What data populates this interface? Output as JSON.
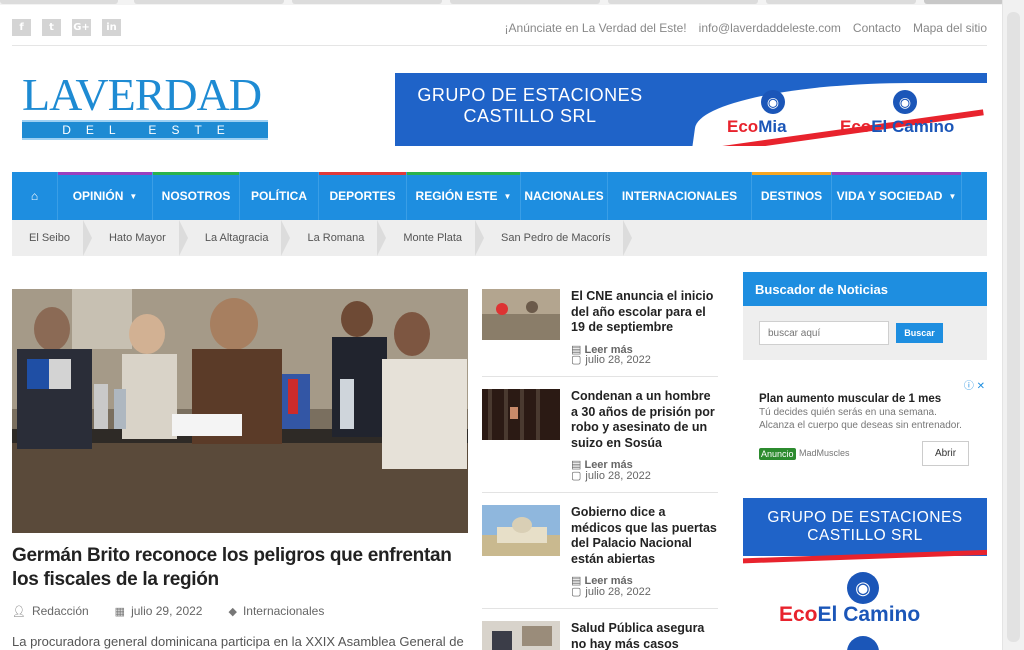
{
  "social": [
    "f",
    "t",
    "G+",
    "in"
  ],
  "top_links": [
    "¡Anúnciate en La Verdad del Este!",
    "info@laverdaddeleste.com",
    "Contacto",
    "Mapa del sitio"
  ],
  "logo": {
    "word": "LAVERDAD",
    "band": "DEL ESTE"
  },
  "banner": {
    "line1": "GRUPO DE ESTACIONES",
    "line2": "CASTILLO SRL",
    "brand1_prefix": "Eco",
    "brand1_suffix": "Mia",
    "brand2_prefix": "Eco",
    "brand2_suffix": "El Camino"
  },
  "main_nav": [
    {
      "label": "⌂",
      "color": "#1e8ee0"
    },
    {
      "label": "OPINIÓN",
      "caret": "▼",
      "color": "#9b3fbf"
    },
    {
      "label": "NOSOTROS",
      "color": "#2bb24c"
    },
    {
      "label": "POLÍTICA",
      "color": "#1e8ee0"
    },
    {
      "label": "DEPORTES",
      "color": "#e03a3a"
    },
    {
      "label": "REGIÓN ESTE",
      "caret": "▼",
      "color": "#2bb24c"
    },
    {
      "label": "NACIONALES",
      "color": "#1e8ee0"
    },
    {
      "label": "INTERNACIONALES",
      "color": "#1e8ee0"
    },
    {
      "label": "DESTINOS",
      "color": "#f5a623"
    },
    {
      "label": "VIDA Y SOCIEDAD",
      "caret": "▼",
      "color": "#9b3fbf"
    }
  ],
  "sub_nav": [
    "El Seibo",
    "Hato Mayor",
    "La Altagracia",
    "La Romana",
    "Monte Plata",
    "San Pedro de Macorís"
  ],
  "featured": {
    "title": "Germán Brito reconoce los peligros que enfrentan los fiscales de la región",
    "author": "Redacción",
    "date": "julio 29, 2022",
    "category": "Internacionales",
    "excerpt": "La procuradora general dominicana participa en la XXIX Asamblea General de"
  },
  "news": [
    {
      "title": "El CNE anuncia el inicio del año escolar para el 19 de septiembre",
      "more": "Leer más",
      "date": "julio 28, 2022"
    },
    {
      "title": "Condenan a un hombre a 30 años de prisión por robo y asesinato de un suizo en Sosúa",
      "more": "Leer más",
      "date": "julio 28, 2022"
    },
    {
      "title": "Gobierno dice a médicos que las puertas del Palacio Nacional están abiertas",
      "more": "Leer más",
      "date": "julio 28, 2022"
    },
    {
      "title": "Salud Pública asegura no hay más casos activos de"
    }
  ],
  "search": {
    "header": "Buscador de Noticias",
    "placeholder": "buscar aquí",
    "button": "Buscar"
  },
  "ad": {
    "title": "Plan aumento muscular de 1 mes",
    "desc": "Tú decides quién serás en una semana. Alcanza el cuerpo que deseas sin entrenador.",
    "tag": "Anuncio",
    "source": "MadMuscles",
    "button": "Abrir",
    "close": "ⓘ ✕"
  },
  "side_banner": {
    "line1": "GRUPO DE ESTACIONES",
    "line2": "CASTILLO SRL",
    "brand_prefix": "Eco",
    "brand_suffix": "El Camino"
  },
  "icons": {
    "home": "home-icon",
    "user": "user-icon",
    "calendar": "calendar-icon",
    "tag": "tag-icon",
    "comment": "comment-icon",
    "clock": "clock-icon"
  }
}
